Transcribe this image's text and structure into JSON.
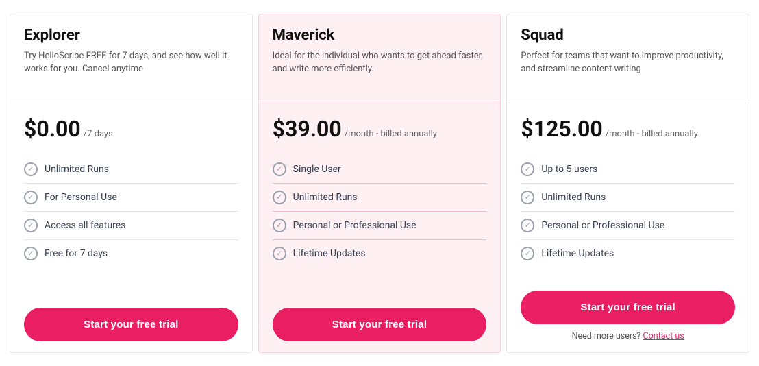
{
  "plans": [
    {
      "id": "explorer",
      "name": "Explorer",
      "description": "Try HelloScribe  FREE for 7 days, and see how well it works for you. Cancel anytime",
      "price": "$0.00",
      "price_period": "/7 days",
      "featured": false,
      "features": [
        "Unlimited Runs",
        "For Personal Use",
        "Access all features",
        "Free for 7 days"
      ],
      "cta_label": "Start your free trial",
      "contact_note": null,
      "contact_link": null
    },
    {
      "id": "maverick",
      "name": "Maverick",
      "description": "Ideal for the individual who wants to get ahead faster, and write more efficiently.",
      "price": "$39.00",
      "price_period": "/month - billed annually",
      "featured": true,
      "features": [
        "Single User",
        "Unlimited Runs",
        "Personal or Professional Use",
        "Lifetime Updates"
      ],
      "cta_label": "Start your free trial",
      "contact_note": null,
      "contact_link": null
    },
    {
      "id": "squad",
      "name": "Squad",
      "description": "Perfect for teams that want to improve productivity, and streamline content writing",
      "price": "$125.00",
      "price_period": "/month - billed annually",
      "featured": false,
      "features": [
        "Up to 5 users",
        "Unlimited Runs",
        "Personal or Professional Use",
        "Lifetime Updates"
      ],
      "cta_label": "Start your free trial",
      "contact_note": "Need more users?",
      "contact_link": "Contact us"
    }
  ],
  "icons": {
    "check": "✓"
  }
}
